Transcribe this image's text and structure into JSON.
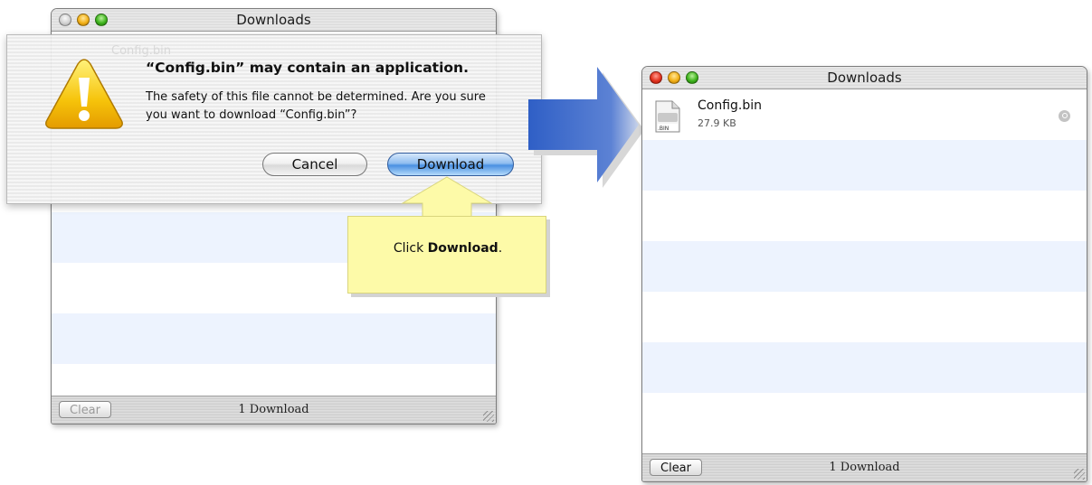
{
  "left_window": {
    "title": "Downloads",
    "clear_label": "Clear",
    "status": "1 Download"
  },
  "sheet": {
    "ghost_filename": "Config.bin",
    "title": "“Config.bin” may contain an application.",
    "message": "The safety of this file cannot be determined. Are you sure you want to download “Config.bin”?",
    "cancel_label": "Cancel",
    "download_label": "Download"
  },
  "callout": {
    "prefix": "Click ",
    "bold": "Download",
    "suffix": "."
  },
  "right_window": {
    "title": "Downloads",
    "file": {
      "name": "Config.bin",
      "size": "27.9 KB",
      "icon_label": ".BIN"
    },
    "clear_label": "Clear",
    "status": "1 Download"
  },
  "colors": {
    "row_alt": "#edf3fe",
    "callout_bg": "#fdfaa8",
    "arrow_blue": "#2f5fc6",
    "download_button": "#4a90e2"
  }
}
